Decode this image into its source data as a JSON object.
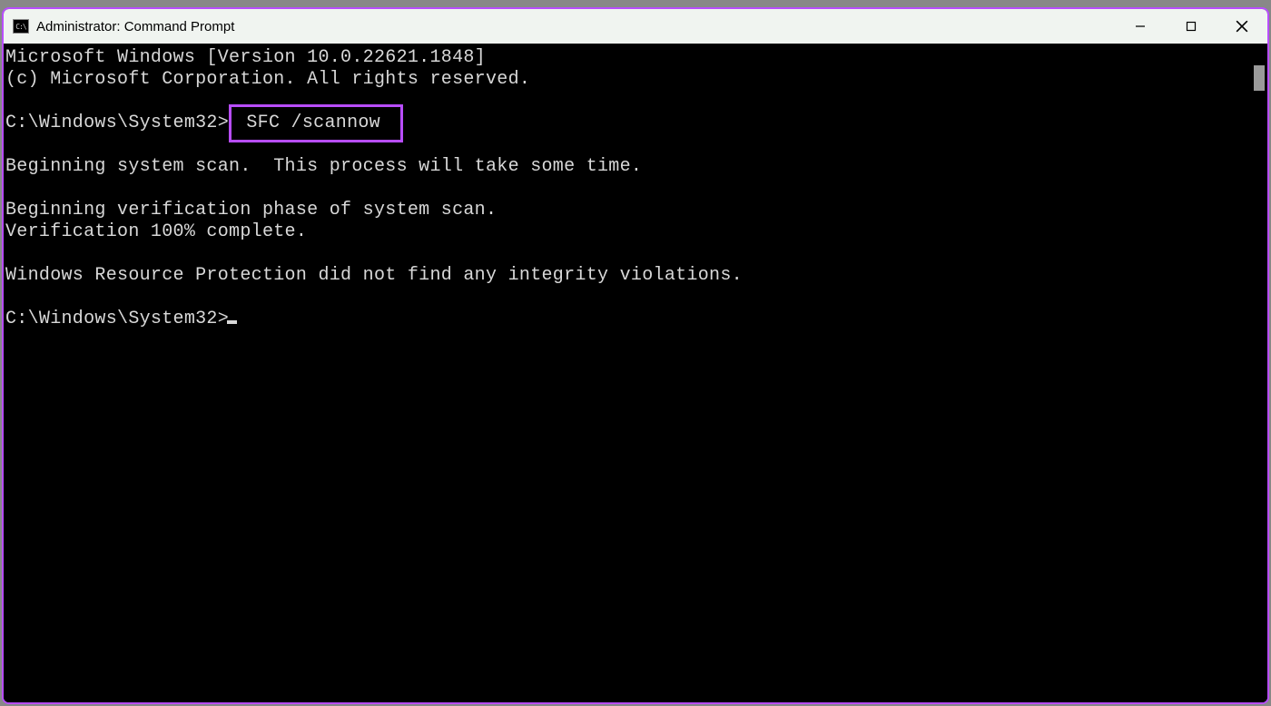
{
  "window": {
    "title": "Administrator: Command Prompt",
    "icon_label": "C:\\"
  },
  "terminal": {
    "line_version": "Microsoft Windows [Version 10.0.22621.1848]",
    "line_copyright": "(c) Microsoft Corporation. All rights reserved.",
    "prompt1_path": "C:\\Windows\\System32>",
    "prompt1_command": " SFC /scannow ",
    "line_begin_scan": "Beginning system scan.  This process will take some time.",
    "line_begin_verify": "Beginning verification phase of system scan.",
    "line_verify_done": "Verification 100% complete.",
    "line_result": "Windows Resource Protection did not find any integrity violations.",
    "prompt2_path": "C:\\Windows\\System32>"
  },
  "highlight_color": "#b84dff"
}
